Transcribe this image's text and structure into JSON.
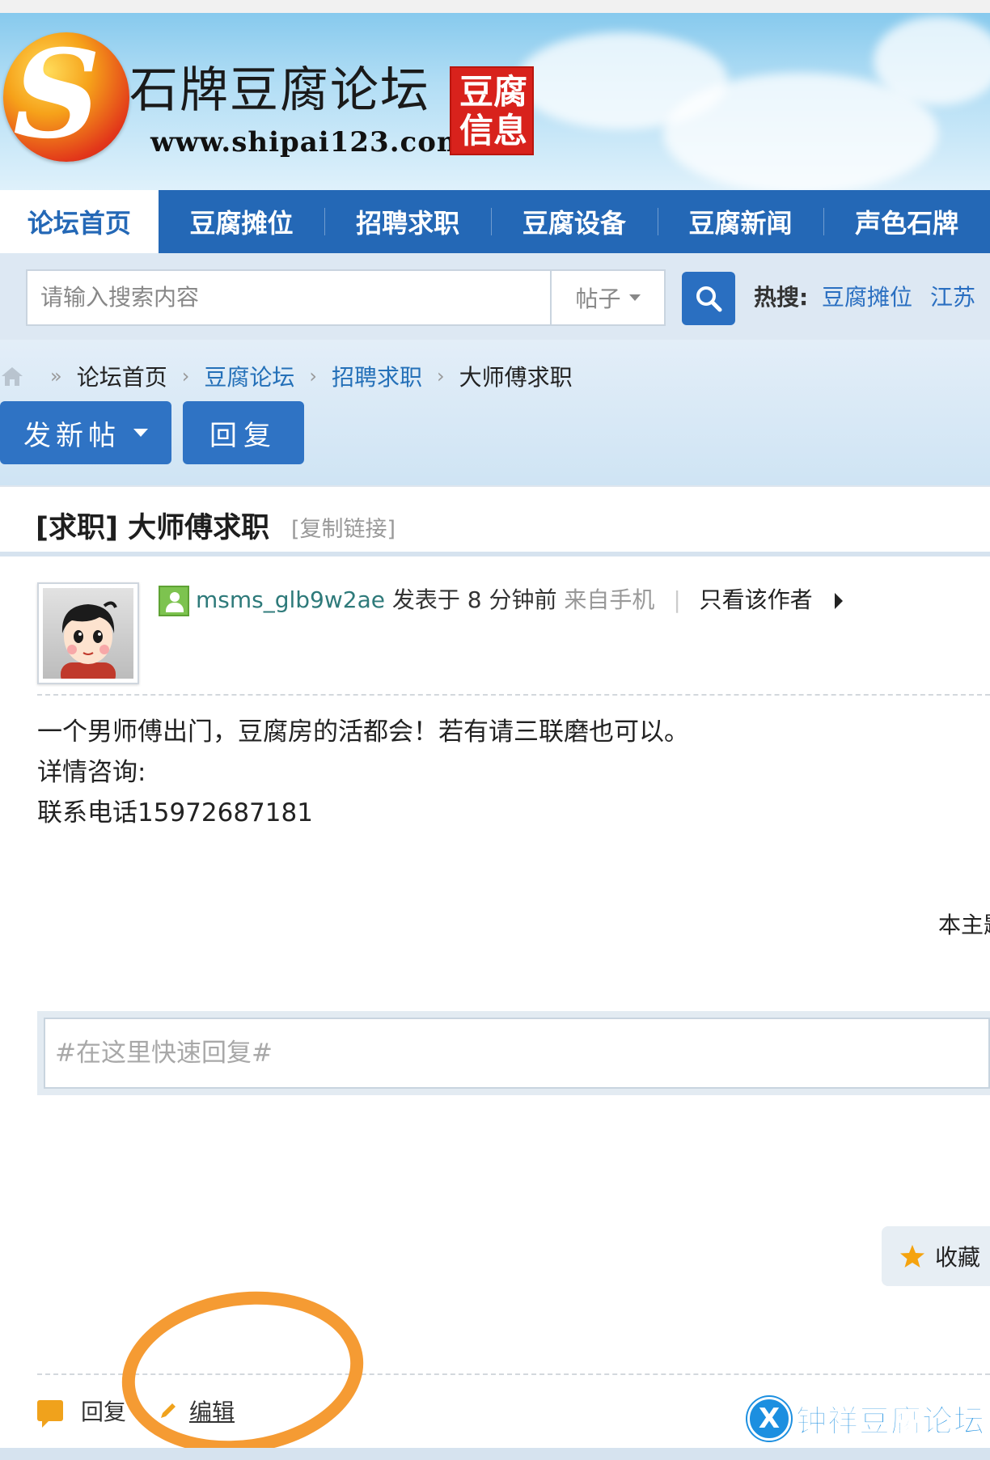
{
  "header": {
    "site_name": "石牌豆腐论坛",
    "site_url": "www.shipai123.com",
    "seal_text": "豆腐信息"
  },
  "nav": {
    "items": [
      "论坛首页",
      "豆腐摊位",
      "招聘求职",
      "豆腐设备",
      "豆腐新闻",
      "声色石牌"
    ],
    "active_index": 0
  },
  "search": {
    "placeholder": "请输入搜索内容",
    "type_label": "帖子",
    "hot_label": "热搜:",
    "hot_items": [
      "豆腐摊位",
      "江苏"
    ]
  },
  "breadcrumb": [
    "论坛首页",
    "豆腐论坛",
    "招聘求职",
    "大师傅求职"
  ],
  "actions": {
    "new_post": "发新帖",
    "reply": "回复"
  },
  "thread": {
    "title": "[求职] 大师傅求职",
    "copy_link": "[复制链接]"
  },
  "post": {
    "author": "msms_glb9w2ae",
    "posted_at": "发表于 8 分钟前",
    "source": "来自手机",
    "only_author": "只看该作者",
    "body": [
      "一个男师傅出门，豆腐房的活都会！若有请三联磨也可以。",
      "详情咨询:",
      "联系电话15972687181"
    ],
    "topic_note": "本主题"
  },
  "quick_reply": {
    "placeholder": "#在这里快速回复#"
  },
  "favorite": {
    "label": "收藏"
  },
  "footer_actions": {
    "reply": "回复",
    "edit": "编辑"
  },
  "watermark": {
    "text": "钟祥豆腐论坛"
  },
  "colors": {
    "nav_blue": "#2468b6",
    "button_blue": "#2f73c4",
    "link_blue": "#2470b8",
    "author_teal": "#2e7a7a",
    "seal_red": "#d8221c",
    "annotation_orange": "#f59b33"
  }
}
